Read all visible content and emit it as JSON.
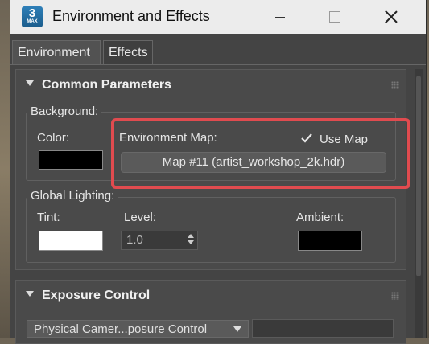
{
  "window": {
    "title": "Environment and Effects",
    "app_icon_text": "3",
    "app_icon_subtext": "MAX"
  },
  "tabs": [
    {
      "label": "Environment",
      "active": true
    },
    {
      "label": "Effects",
      "active": false
    }
  ],
  "common": {
    "header": "Common Parameters",
    "background": {
      "group_label": "Background:",
      "color_label": "Color:",
      "color_value": "#000000",
      "env_map_label": "Environment Map:",
      "use_map_label": "Use Map",
      "use_map_checked": true,
      "map_button": "Map #11 (artist_workshop_2k.hdr)"
    },
    "global_lighting": {
      "group_label": "Global Lighting:",
      "tint_label": "Tint:",
      "tint_value": "#ffffff",
      "level_label": "Level:",
      "level_value": "1.0",
      "ambient_label": "Ambient:",
      "ambient_value": "#000000"
    }
  },
  "exposure": {
    "header": "Exposure Control",
    "dropdown_value": "Physical Camer...posure Control"
  },
  "colors": {
    "highlight": "#e04b4f",
    "panel_bg": "#4a4a4a"
  }
}
